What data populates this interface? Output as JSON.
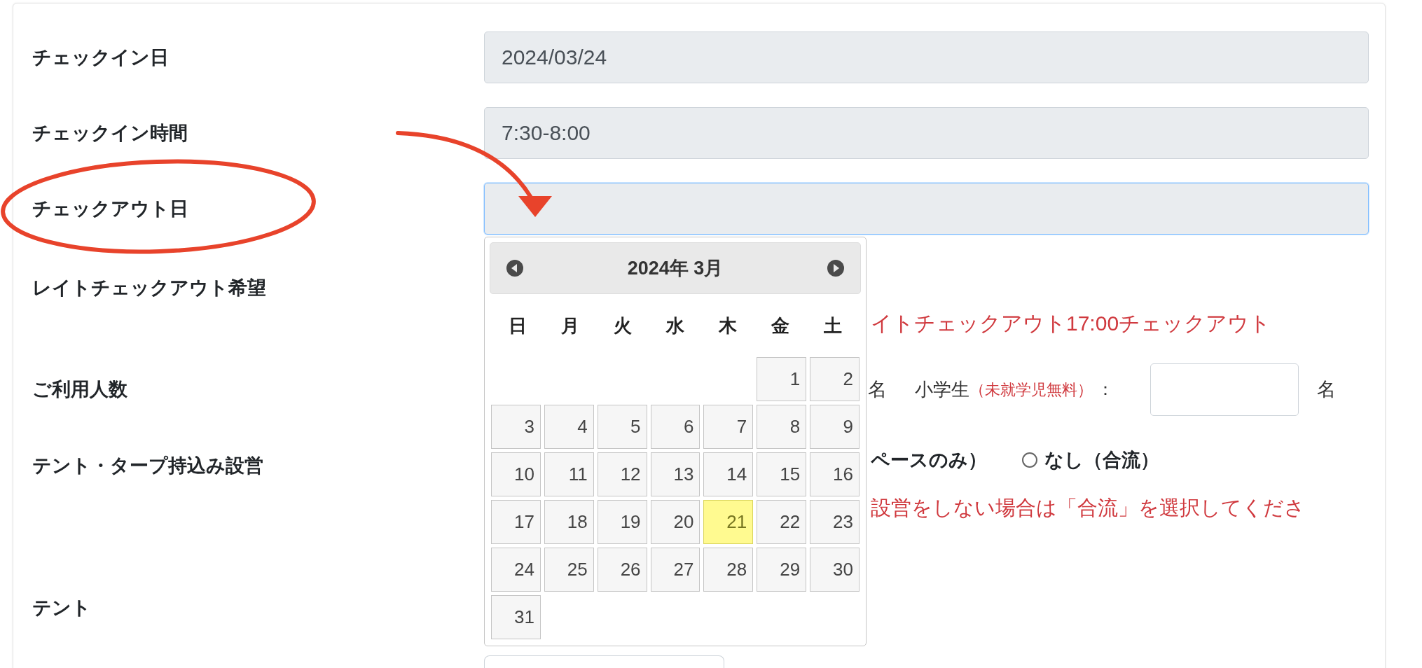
{
  "rows": [
    {
      "label": "チェックイン日",
      "kind": "field",
      "field": {
        "value": "2024/03/24",
        "focused": false
      }
    },
    {
      "label": "チェックイン時間",
      "kind": "field",
      "field": {
        "value": "7:30-8:00",
        "focused": false
      }
    },
    {
      "label": "チェックアウト日",
      "kind": "field",
      "field": {
        "focused": true
      }
    },
    {
      "label": "レイトチェックアウト希望",
      "kind": "note",
      "note": "イトチェックアウト17:00チェックアウト"
    },
    {
      "label": "ご利用人数",
      "kind": "people",
      "people": {
        "unit_before": "名",
        "child_label": "小学生",
        "child_note": "（未就学児無料）",
        "colon": "：",
        "unit_after": "名"
      }
    },
    {
      "label": "テント・タープ持込み設営",
      "kind": "radio",
      "option_tail": "ペースのみ）",
      "radio": {
        "label": "なし（合流）",
        "selected": false
      },
      "note": "設営をしない場合は「合流」を選択してくださ"
    },
    {
      "label": "テント",
      "kind": "label"
    },
    {
      "kind": "partial-field"
    }
  ],
  "calendar": {
    "title": "2024年 3月",
    "weekdays": [
      "日",
      "月",
      "火",
      "水",
      "木",
      "金",
      "土"
    ],
    "weeks": [
      [
        {
          "kind": "blank"
        },
        {
          "kind": "blank"
        },
        {
          "kind": "blank"
        },
        {
          "kind": "blank"
        },
        {
          "kind": "blank"
        },
        {
          "kind": "day",
          "day": "1",
          "highlighted": false
        },
        {
          "kind": "day",
          "day": "2",
          "highlighted": false
        }
      ],
      [
        {
          "kind": "day",
          "day": "3",
          "highlighted": false
        },
        {
          "kind": "day",
          "day": "4",
          "highlighted": false
        },
        {
          "kind": "day",
          "day": "5",
          "highlighted": false
        },
        {
          "kind": "day",
          "day": "6",
          "highlighted": false
        },
        {
          "kind": "day",
          "day": "7",
          "highlighted": false
        },
        {
          "kind": "day",
          "day": "8",
          "highlighted": false
        },
        {
          "kind": "day",
          "day": "9",
          "highlighted": false
        }
      ],
      [
        {
          "kind": "day",
          "day": "10",
          "highlighted": false
        },
        {
          "kind": "day",
          "day": "11",
          "highlighted": false
        },
        {
          "kind": "day",
          "day": "12",
          "highlighted": false
        },
        {
          "kind": "day",
          "day": "13",
          "highlighted": false
        },
        {
          "kind": "day",
          "day": "14",
          "highlighted": false
        },
        {
          "kind": "day",
          "day": "15",
          "highlighted": false
        },
        {
          "kind": "day",
          "day": "16",
          "highlighted": false
        }
      ],
      [
        {
          "kind": "day",
          "day": "17",
          "highlighted": false
        },
        {
          "kind": "day",
          "day": "18",
          "highlighted": false
        },
        {
          "kind": "day",
          "day": "19",
          "highlighted": false
        },
        {
          "kind": "day",
          "day": "20",
          "highlighted": false
        },
        {
          "kind": "day",
          "day": "21",
          "highlighted": true
        },
        {
          "kind": "day",
          "day": "22",
          "highlighted": false
        },
        {
          "kind": "day",
          "day": "23",
          "highlighted": false
        }
      ],
      [
        {
          "kind": "day",
          "day": "24",
          "highlighted": false
        },
        {
          "kind": "day",
          "day": "25",
          "highlighted": false
        },
        {
          "kind": "day",
          "day": "26",
          "highlighted": false
        },
        {
          "kind": "day",
          "day": "27",
          "highlighted": false
        },
        {
          "kind": "day",
          "day": "28",
          "highlighted": false
        },
        {
          "kind": "day",
          "day": "29",
          "highlighted": false
        },
        {
          "kind": "day",
          "day": "30",
          "highlighted": false
        }
      ],
      [
        {
          "kind": "day",
          "day": "31",
          "highlighted": false
        },
        {
          "kind": "blank"
        },
        {
          "kind": "blank"
        },
        {
          "kind": "blank"
        },
        {
          "kind": "blank"
        },
        {
          "kind": "blank"
        },
        {
          "kind": "blank"
        }
      ]
    ]
  }
}
